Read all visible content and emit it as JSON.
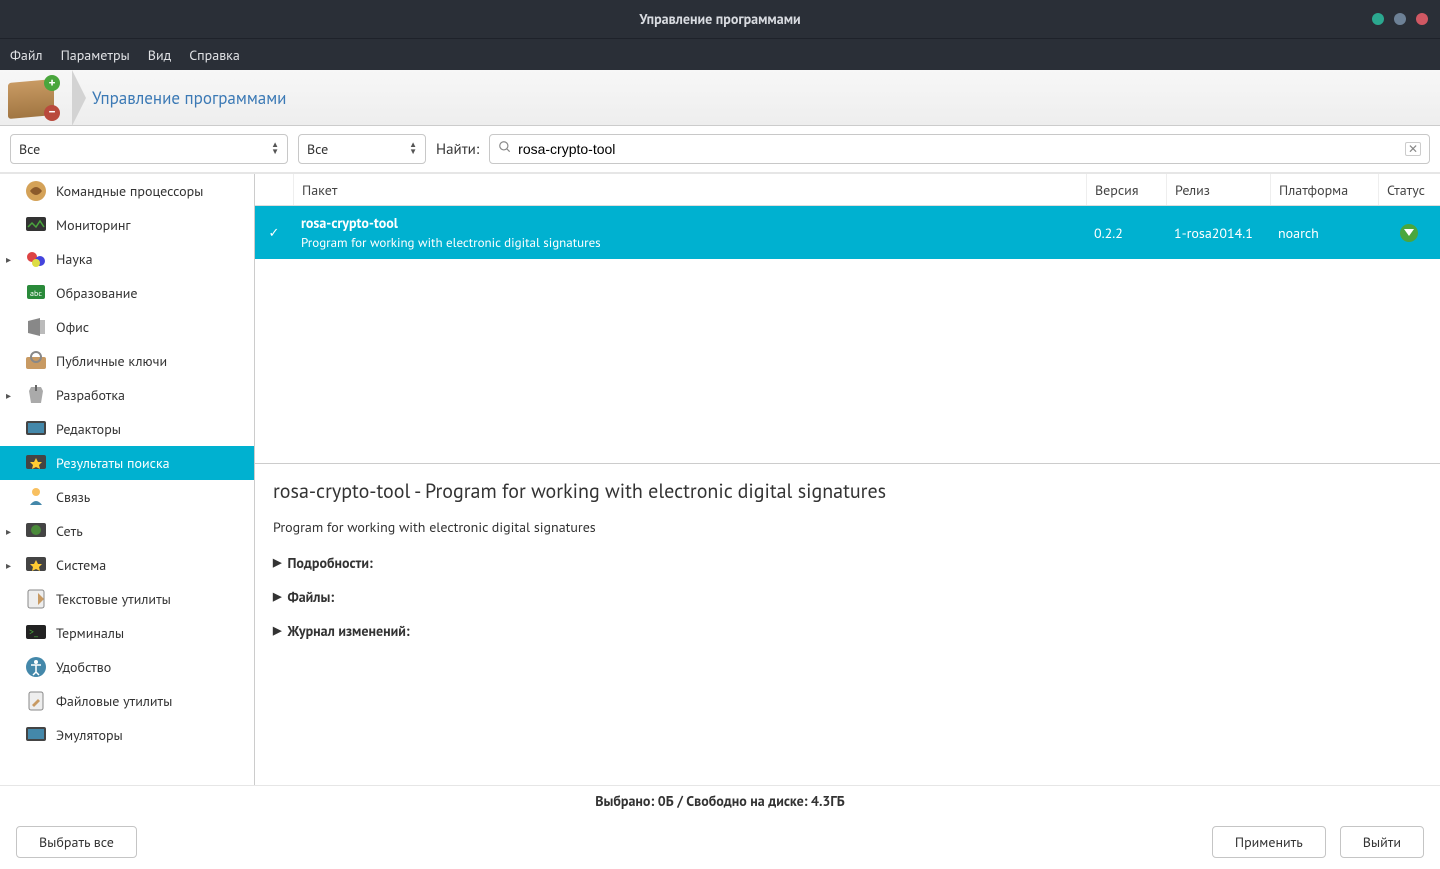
{
  "window": {
    "title": "Управление программами"
  },
  "menubar": {
    "items": [
      "Файл",
      "Параметры",
      "Вид",
      "Справка"
    ]
  },
  "subheader": {
    "title": "Управление программами"
  },
  "filters": {
    "dropdown1": "Все",
    "dropdown2": "Все",
    "search_label": "Найти:",
    "search_value": "rosa-crypto-tool"
  },
  "sidebar": {
    "items": [
      {
        "label": "Командные процессоры",
        "expandable": false,
        "selected": false,
        "icon": "cmd"
      },
      {
        "label": "Мониторинг",
        "expandable": false,
        "selected": false,
        "icon": "monitor"
      },
      {
        "label": "Наука",
        "expandable": true,
        "selected": false,
        "icon": "science"
      },
      {
        "label": "Образование",
        "expandable": false,
        "selected": false,
        "icon": "education"
      },
      {
        "label": "Офис",
        "expandable": false,
        "selected": false,
        "icon": "office"
      },
      {
        "label": "Публичные ключи",
        "expandable": false,
        "selected": false,
        "icon": "keys"
      },
      {
        "label": "Разработка",
        "expandable": true,
        "selected": false,
        "icon": "dev"
      },
      {
        "label": "Редакторы",
        "expandable": false,
        "selected": false,
        "icon": "editors"
      },
      {
        "label": "Результаты поиска",
        "expandable": false,
        "selected": true,
        "icon": "search-results"
      },
      {
        "label": "Связь",
        "expandable": false,
        "selected": false,
        "icon": "comm"
      },
      {
        "label": "Сеть",
        "expandable": true,
        "selected": false,
        "icon": "network"
      },
      {
        "label": "Система",
        "expandable": true,
        "selected": false,
        "icon": "system"
      },
      {
        "label": "Текстовые утилиты",
        "expandable": false,
        "selected": false,
        "icon": "text-util"
      },
      {
        "label": "Терминалы",
        "expandable": false,
        "selected": false,
        "icon": "terminal"
      },
      {
        "label": "Удобство",
        "expandable": false,
        "selected": false,
        "icon": "accessibility"
      },
      {
        "label": "Файловые утилиты",
        "expandable": false,
        "selected": false,
        "icon": "file-util"
      },
      {
        "label": "Эмуляторы",
        "expandable": false,
        "selected": false,
        "icon": "emulators"
      }
    ]
  },
  "table": {
    "headers": {
      "package": "Пакет",
      "version": "Версия",
      "release": "Релиз",
      "platform": "Платформа",
      "status": "Статус"
    },
    "rows": [
      {
        "name": "rosa-crypto-tool",
        "desc": "Program for working with electronic digital signatures",
        "version": "0.2.2",
        "release": "1-rosa2014.1",
        "platform": "noarch",
        "checked": true
      }
    ]
  },
  "details": {
    "title": "rosa-crypto-tool - Program for working with electronic digital signatures",
    "description": "Program for working with electronic digital signatures",
    "sections": [
      "Подробности:",
      "Файлы:",
      "Журнал изменений:"
    ]
  },
  "statusbar": "Выбрано: 0Б / Свободно на диске: 4.3ГБ",
  "buttons": {
    "select_all": "Выбрать все",
    "apply": "Применить",
    "exit": "Выйти"
  }
}
